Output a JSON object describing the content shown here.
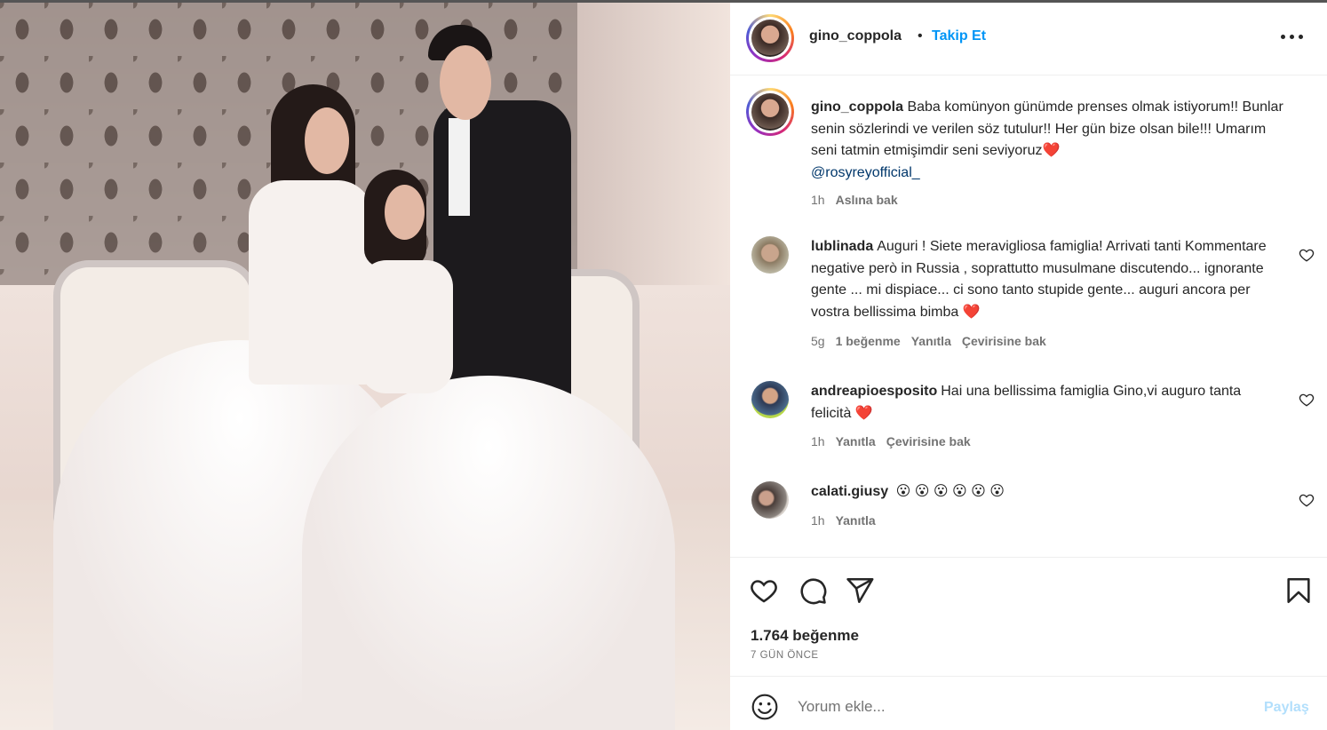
{
  "post": {
    "author": "gino_coppola",
    "follow_label": "Takip Et",
    "separator": "•",
    "caption_user": "gino_coppola",
    "caption": "Baba komünyon günümde prenses olmak istiyorum!! Bunlar senin sözlerindi ve verilen söz tutulur!! Her gün bize olsan bile!!! Umarım seni tatmin etmişimdir seni seviyoruz",
    "caption_emoji": "❤️",
    "caption_mention": "@rosyreyofficial_",
    "caption_time": "1h",
    "caption_translate": "Aslına bak"
  },
  "comments": [
    {
      "user": "lublinada",
      "text": "Auguri ! Siete meravigliosa famiglia! Arrivati tanti Kommentare negative però in Russia , soprattutto musulmane discutendo... ignorante gente ... mi dispiace... ci sono tanto stupide gente... auguri ancora per vostra bellissima bimba",
      "emoji": "❤️",
      "time": "5g",
      "likes": "1 beğenme",
      "reply": "Yanıtla",
      "translate": "Çevirisine bak"
    },
    {
      "user": "andreapioesposito",
      "text": "Hai una bellissima famiglia Gino,vi auguro tanta felicità",
      "emoji": "❤️",
      "time": "1h",
      "reply": "Yanıtla",
      "translate": "Çevirisine bak"
    },
    {
      "user": "calati.giusy",
      "text": "",
      "emoji": "😮 😮 😮 😮 😮 😮",
      "time": "1h",
      "reply": "Yanıtla"
    }
  ],
  "stats": {
    "likes": "1.764 beğenme",
    "date": "7 GÜN ÖNCE"
  },
  "comment_box": {
    "placeholder": "Yorum ekle...",
    "submit": "Paylaş"
  },
  "icons": {
    "more": "more-options-icon",
    "like": "heart-icon",
    "comment": "comment-icon",
    "share": "send-icon",
    "save": "bookmark-icon",
    "emoji": "emoji-icon"
  },
  "colors": {
    "link": "#0095f6",
    "mention": "#00376b",
    "heart": "#ed2d3a",
    "muted": "#737373",
    "submit_disabled": "#b2dffc"
  }
}
